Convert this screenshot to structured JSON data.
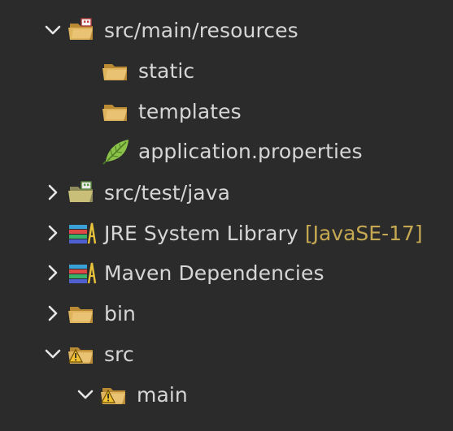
{
  "tree": {
    "items": [
      {
        "key": "resources",
        "label": "src/main/resources",
        "icon": "package-folder-icon",
        "chevron": "down",
        "decoration": ""
      },
      {
        "key": "static",
        "label": "static",
        "icon": "folder-icon",
        "chevron": "none",
        "decoration": ""
      },
      {
        "key": "templates",
        "label": "templates",
        "icon": "folder-icon",
        "chevron": "none",
        "decoration": ""
      },
      {
        "key": "application-properties",
        "label": "application.properties",
        "icon": "properties-file-icon",
        "chevron": "none",
        "decoration": ""
      },
      {
        "key": "test-java",
        "label": "src/test/java",
        "icon": "source-folder-icon",
        "chevron": "right",
        "decoration": ""
      },
      {
        "key": "jre-library",
        "label": "JRE System Library",
        "icon": "library-icon",
        "chevron": "right",
        "decoration": "[JavaSE-17]"
      },
      {
        "key": "maven-deps",
        "label": "Maven Dependencies",
        "icon": "library-icon",
        "chevron": "right",
        "decoration": ""
      },
      {
        "key": "bin",
        "label": "bin",
        "icon": "folder-icon",
        "chevron": "right",
        "decoration": ""
      },
      {
        "key": "src",
        "label": "src",
        "icon": "folder-warning-icon",
        "chevron": "down",
        "decoration": ""
      },
      {
        "key": "main",
        "label": "main",
        "icon": "folder-warning-icon",
        "chevron": "down",
        "decoration": ""
      }
    ]
  },
  "colors": {
    "background": "#2b2b2b",
    "text": "#d6d6d6",
    "decoration": "#c5a852",
    "chevron": "#e6e6e6",
    "folder": "#e0b45c",
    "warning": "#f2c233",
    "leaf": "#8bc34a"
  }
}
